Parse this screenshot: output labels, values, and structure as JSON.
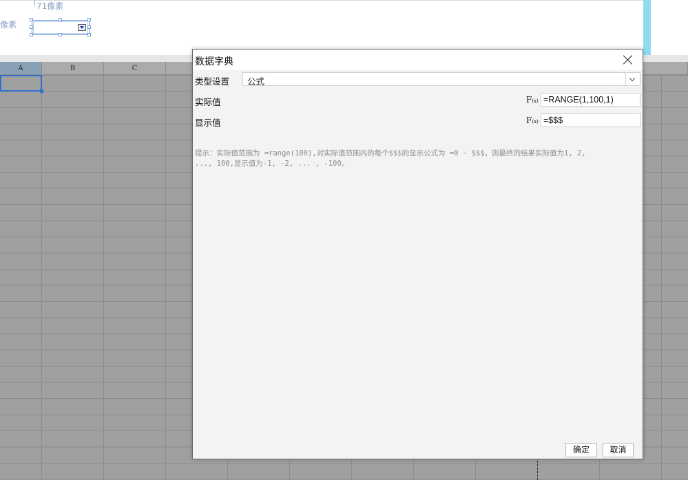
{
  "canvas": {
    "top_label": "71像素",
    "left_label": "像素"
  },
  "sheet": {
    "columns": [
      "A",
      "B",
      "C"
    ],
    "selected_column": "A"
  },
  "dialog": {
    "title": "数据字典",
    "type_label": "类型设置",
    "type_value": "公式",
    "actual_label": "实际值",
    "actual_formula": "=RANGE(1,100,1)",
    "display_label": "显示值",
    "display_formula": "=$$$",
    "fx_symbol": "F",
    "fx_sub": "(x)",
    "hint_line1": "提示：实际值范围为 =range(100),对实际值范围内的每个$$$的显示公式为 =0 - $$$，则最终的结果实际值为1, 2,",
    "hint_line2": "..., 100,显示值为-1, -2, ... , -100。",
    "ok_label": "确定",
    "cancel_label": "取消"
  },
  "colors": {
    "accent": "#2f6fd3",
    "cyan_strip": "#8fdcf0",
    "grid_bg": "#a0a0a0"
  }
}
